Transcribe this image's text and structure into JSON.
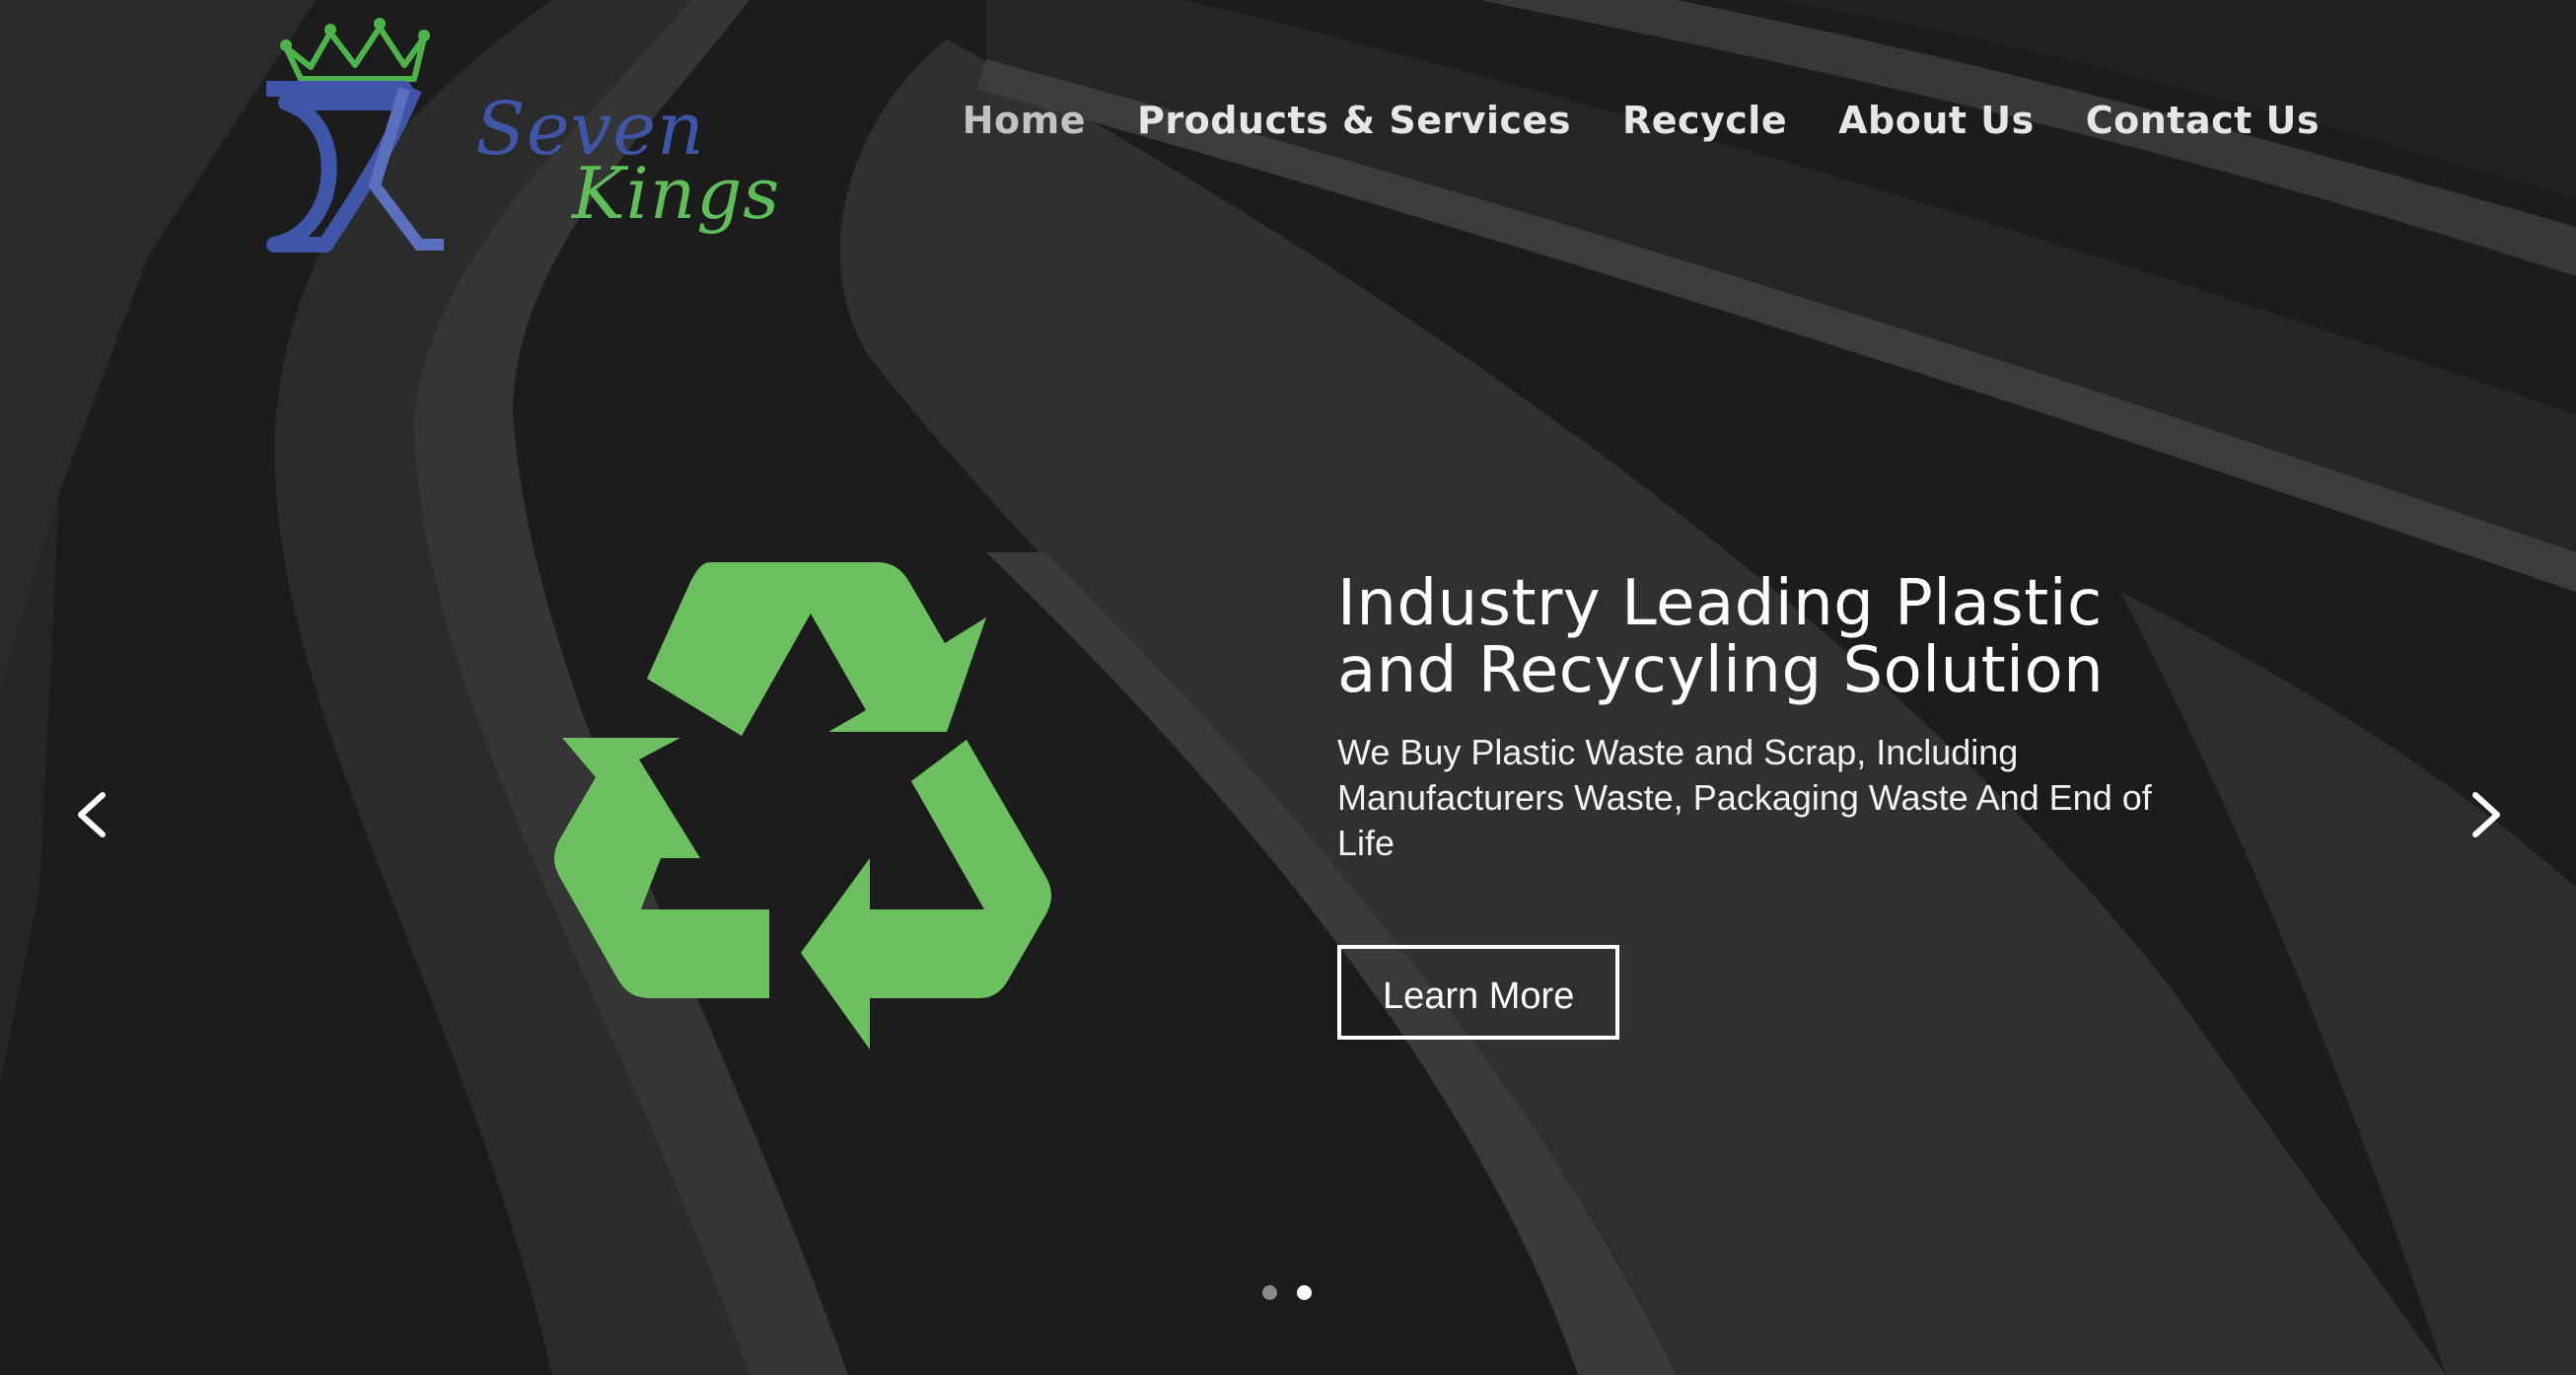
{
  "brand": {
    "monogram": "SK",
    "name_line1": "Seven",
    "name_line2": "Kings",
    "colors": {
      "blue": "#3f55a8",
      "green": "#5fbe5a"
    }
  },
  "nav": {
    "items": [
      {
        "label": "Home",
        "active": true
      },
      {
        "label": "Products & Services",
        "active": false
      },
      {
        "label": "Recycle",
        "active": false
      },
      {
        "label": "About Us",
        "active": false
      },
      {
        "label": "Contact Us",
        "active": false
      }
    ]
  },
  "slider": {
    "headline": "Industry Leading Plastic and Recycyling Solution",
    "subtext": "We Buy Plastic Waste and Scrap, Including Manufacturers Waste, Packaging Waste And End of Life",
    "button_label": "Learn More",
    "prev_icon": "chevron-left-icon",
    "next_icon": "chevron-right-icon",
    "slide_count": 2,
    "active_slide": 2,
    "recycle_icon": "recycle-icon",
    "recycle_color": "#6cc05f"
  }
}
